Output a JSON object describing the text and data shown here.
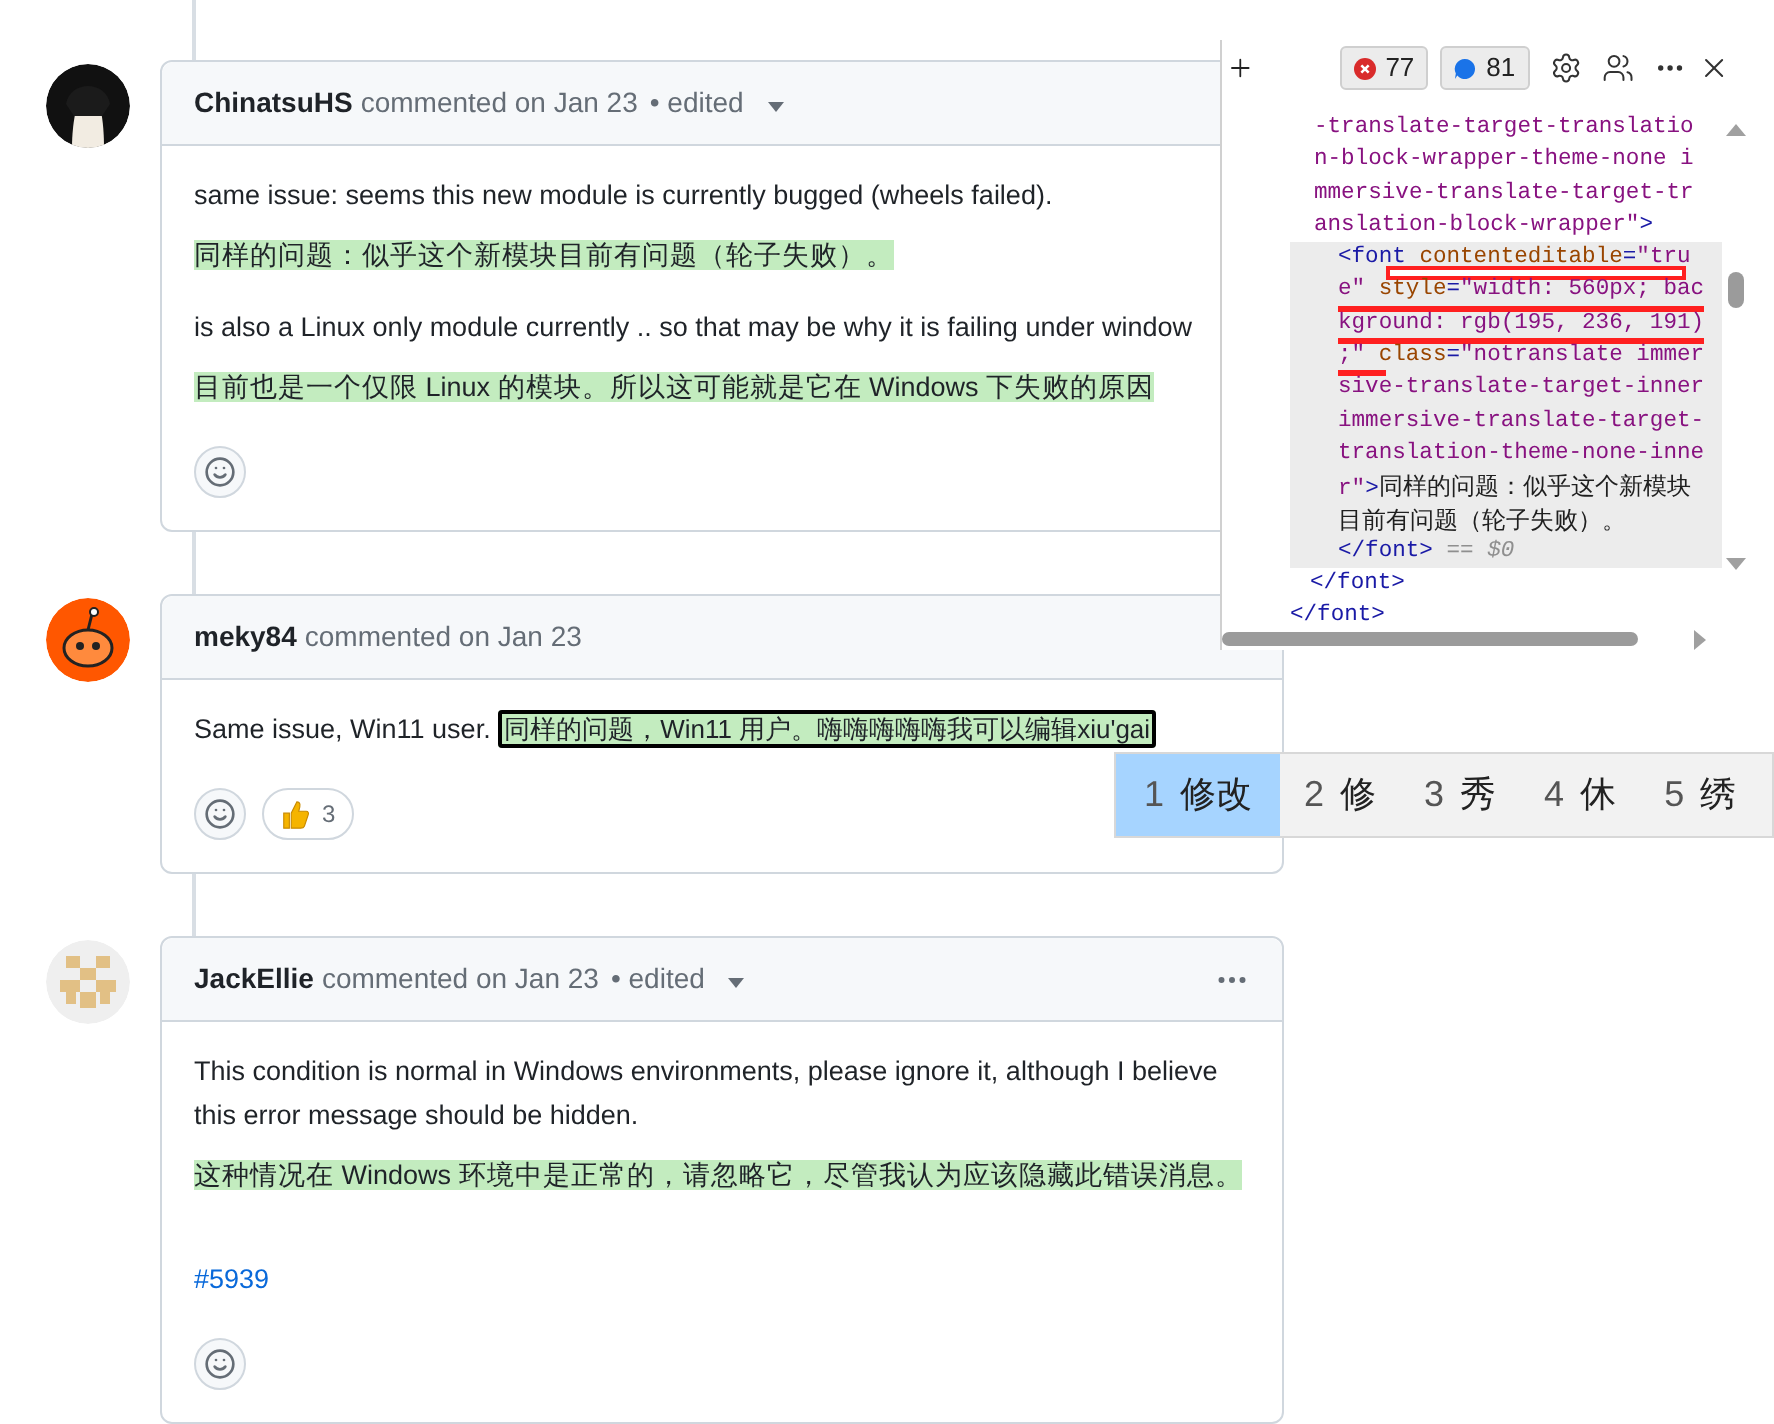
{
  "comments": [
    {
      "author": "ChinatsuHS",
      "meta": "commented on Jan 23",
      "edited": "• edited",
      "avatar": {
        "kind": "dark"
      },
      "paragraphs": [
        [
          {
            "kind": "text",
            "text": "same issue: seems this new module is currently bugged (wheels failed)."
          }
        ],
        [
          {
            "kind": "translation",
            "text": "同样的问题：似乎这个新模块目前有问题（轮子失败）。"
          }
        ],
        [
          {
            "kind": "text",
            "text": "is also a Linux only module currently .. so that may be why it is failing under window"
          }
        ],
        [
          {
            "kind": "translation",
            "text": "目前也是一个仅限 Linux 的模块。所以这可能就是它在 Windows 下失败的原因"
          }
        ]
      ]
    },
    {
      "author": "meky84",
      "meta": "commented on Jan 23",
      "avatar": {
        "kind": "orange"
      },
      "paragraphs": [
        [
          {
            "kind": "text",
            "text": "Same issue, Win11 user."
          },
          {
            "kind": "focused",
            "text": "同样的问题，Win11 用户。嗨嗨嗨嗨嗨我可以编辑xiu'gai"
          }
        ]
      ],
      "reactions": [
        {
          "count": "3"
        }
      ]
    },
    {
      "author": "JackEllie",
      "meta": "commented on Jan 23",
      "edited": "• edited",
      "avatar": {
        "kind": "identicon"
      },
      "menu": true,
      "paragraphs": [
        [
          {
            "kind": "text",
            "text": "This condition is normal in Windows environments, please ignore it, although I believe this error message should be hidden."
          }
        ],
        [
          {
            "kind": "translation",
            "text": "这种情况在 Windows 环境中是正常的，请忽略它，尽管我认为应该隐藏此错误消息。"
          }
        ],
        [
          {
            "kind": "link",
            "text": "#5939"
          }
        ]
      ]
    }
  ],
  "devtools": {
    "error_count": "77",
    "message_count": "81",
    "tree": {
      "closing": "</font>",
      "children": [
        {
          "selected": false,
          "lines": [
            {
              "segments": [
                {
                  "kind": "value",
                  "text": "-translate-target-translatio"
                }
              ]
            },
            {
              "segments": [
                {
                  "kind": "value",
                  "text": "n-block-wrapper-theme-none i"
                }
              ]
            },
            {
              "segments": [
                {
                  "kind": "value",
                  "text": "mmersive-translate-target-tr"
                }
              ]
            },
            {
              "segments": [
                {
                  "kind": "value",
                  "text": "anslation-block-wrapper\""
                },
                {
                  "kind": "tag",
                  "text": ">"
                }
              ]
            }
          ],
          "closing": "</font>",
          "children": [
            {
              "selected": true,
              "lines": [
                {
                  "annotation": {
                    "kind": "end"
                  },
                  "segments": [
                    {
                      "kind": "tag",
                      "text": "<font "
                    },
                    {
                      "kind": "attr",
                      "text": "contenteditable"
                    },
                    {
                      "kind": "tag",
                      "text": "="
                    },
                    {
                      "kind": "value",
                      "text": "\"tru"
                    }
                  ]
                },
                {
                  "annotation": {
                    "kind": "full"
                  },
                  "segments": [
                    {
                      "kind": "value",
                      "text": "e\" "
                    },
                    {
                      "kind": "attr",
                      "text": "style"
                    },
                    {
                      "kind": "tag",
                      "text": "="
                    },
                    {
                      "kind": "value",
                      "text": "\"width: 560px; bac"
                    }
                  ]
                },
                {
                  "annotation": {
                    "kind": "full"
                  },
                  "segments": [
                    {
                      "kind": "value",
                      "text": "kground: rgb(195, 236, 191)"
                    }
                  ]
                },
                {
                  "annotation": {
                    "kind": "start"
                  },
                  "segments": [
                    {
                      "kind": "value",
                      "text": ";\" "
                    },
                    {
                      "kind": "attr",
                      "text": "class"
                    },
                    {
                      "kind": "tag",
                      "text": "="
                    },
                    {
                      "kind": "value",
                      "text": "\"notranslate immer"
                    }
                  ]
                },
                {
                  "segments": [
                    {
                      "kind": "value",
                      "text": "sive-translate-target-inner"
                    }
                  ]
                },
                {
                  "segments": [
                    {
                      "kind": "value",
                      "text": "immersive-translate-target-"
                    }
                  ]
                },
                {
                  "segments": [
                    {
                      "kind": "value",
                      "text": "translation-theme-none-inne"
                    }
                  ]
                },
                {
                  "segments": [
                    {
                      "kind": "value",
                      "text": "r\""
                    },
                    {
                      "kind": "tag",
                      "text": ">"
                    },
                    {
                      "kind": "text",
                      "text": "同样的问题：似乎这个新模块"
                    }
                  ]
                },
                {
                  "segments": [
                    {
                      "kind": "text",
                      "text": "目前有问题（轮子失败）。"
                    }
                  ]
                },
                {
                  "segments": [
                    {
                      "kind": "tag",
                      "text": "</font>"
                    },
                    {
                      "kind": "hint",
                      "text": " == $0"
                    }
                  ]
                }
              ]
            }
          ]
        }
      ]
    }
  },
  "ime": {
    "candidates": [
      {
        "index": "1",
        "text": "修改",
        "selected": true
      },
      {
        "index": "2",
        "text": "修",
        "selected": false
      },
      {
        "index": "3",
        "text": "秀",
        "selected": false
      },
      {
        "index": "4",
        "text": "休",
        "selected": false
      },
      {
        "index": "5",
        "text": "绣",
        "selected": false
      }
    ]
  }
}
